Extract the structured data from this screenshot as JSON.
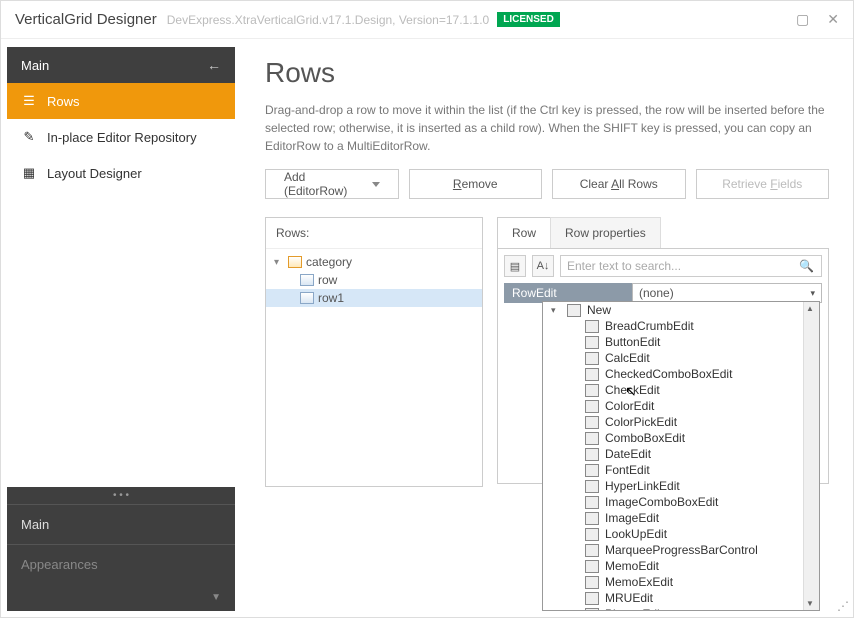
{
  "titlebar": {
    "title": "VerticalGrid Designer",
    "subtitle": "DevExpress.XtraVerticalGrid.v17.1.Design, Version=17.1.1.0",
    "badge": "LICENSED"
  },
  "sidebar": {
    "header": "Main",
    "items": [
      {
        "label": "Rows",
        "active": true
      },
      {
        "label": "In-place Editor Repository",
        "active": false
      },
      {
        "label": "Layout Designer",
        "active": false
      }
    ],
    "section_main": "Main",
    "section_appearances": "Appearances"
  },
  "page": {
    "heading": "Rows",
    "description": "Drag-and-drop a row to move it within the list (if the Ctrl key is pressed, the row will be inserted before the selected row; otherwise, it is inserted as a child row). When the SHIFT key is pressed, you can copy an EditorRow to a MultiEditorRow.",
    "buttons": {
      "add": "Add (EditorRow)",
      "remove_pre": "",
      "remove_u": "R",
      "remove_post": "emove",
      "clear_pre": "Clear ",
      "clear_u": "A",
      "clear_post": "ll Rows",
      "retrieve_pre": "Retrieve ",
      "retrieve_u": "F",
      "retrieve_post": "ields"
    },
    "rows_title": "Rows:",
    "tree": [
      {
        "label": "category",
        "level": 0,
        "selected": false,
        "type": "cat"
      },
      {
        "label": "row",
        "level": 1,
        "selected": false,
        "type": "row"
      },
      {
        "label": "row1",
        "level": 1,
        "selected": true,
        "type": "row"
      }
    ],
    "tabs": {
      "row": "Row",
      "props": "Row properties"
    },
    "search_placeholder": "Enter text to search...",
    "prop_key": "RowEdit",
    "prop_val": "(none)"
  },
  "dropdown": {
    "group": "New",
    "items": [
      "BreadCrumbEdit",
      "ButtonEdit",
      "CalcEdit",
      "CheckedComboBoxEdit",
      "CheckEdit",
      "ColorEdit",
      "ColorPickEdit",
      "ComboBoxEdit",
      "DateEdit",
      "FontEdit",
      "HyperLinkEdit",
      "ImageComboBoxEdit",
      "ImageEdit",
      "LookUpEdit",
      "MarqueeProgressBarControl",
      "MemoEdit",
      "MemoExEdit",
      "MRUEdit",
      "PictureEdit"
    ]
  }
}
